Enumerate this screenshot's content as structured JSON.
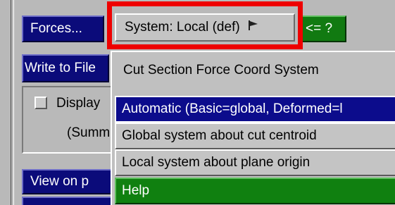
{
  "panel": {
    "forces_label": "Forces...",
    "system_label": "System: Local (def)",
    "query_label": "<= ?",
    "write_label": "Write to File",
    "display_label": "Display",
    "summary_label": "(Summ",
    "view_label": "View on p"
  },
  "popup": {
    "title": "Cut Section Force Coord System",
    "items": [
      {
        "label": "Automatic (Basic=global, Deformed=l"
      },
      {
        "label": "Global system about cut centroid"
      },
      {
        "label": "Local system about plane origin"
      },
      {
        "label": "Help"
      }
    ]
  },
  "colors": {
    "navy": "#0b0b7a",
    "green": "#117a11",
    "highlight": "#ee0000",
    "panel_grey": "#b9b9b9"
  },
  "icons": {
    "dropdown": "flag-icon"
  }
}
